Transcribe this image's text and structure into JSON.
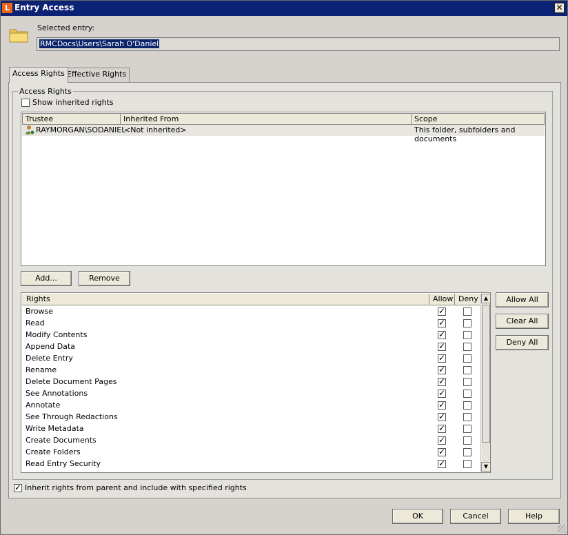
{
  "window": {
    "title": "Entry Access",
    "app_icon_letter": "L",
    "close_glyph": "✕"
  },
  "selected_entry": {
    "label": "Selected entry:",
    "value": "RMCDocs\\Users\\Sarah O'Daniel"
  },
  "tabs": [
    {
      "label": "Access Rights",
      "active": true
    },
    {
      "label": "Effective Rights",
      "active": false
    }
  ],
  "group_label": "Access Rights",
  "show_inherited": {
    "label": "Show inherited rights",
    "checked": false
  },
  "trustee_table": {
    "columns": [
      "Trustee",
      "Inherited From",
      "Scope"
    ],
    "rows": [
      {
        "trustee": "RAYMORGAN\\SODANIEL",
        "inherited_from": "<Not inherited>",
        "scope": "This folder, subfolders and documents"
      }
    ]
  },
  "trustee_buttons": {
    "add": "Add...",
    "remove": "Remove"
  },
  "rights_table": {
    "columns": [
      "Rights",
      "Allow",
      "Deny"
    ],
    "rows": [
      {
        "name": "Browse",
        "allow": true,
        "deny": false
      },
      {
        "name": "Read",
        "allow": true,
        "deny": false
      },
      {
        "name": "Modify Contents",
        "allow": true,
        "deny": false
      },
      {
        "name": "Append Data",
        "allow": true,
        "deny": false
      },
      {
        "name": "Delete Entry",
        "allow": true,
        "deny": false
      },
      {
        "name": "Rename",
        "allow": true,
        "deny": false
      },
      {
        "name": "Delete Document Pages",
        "allow": true,
        "deny": false
      },
      {
        "name": "See Annotations",
        "allow": true,
        "deny": false
      },
      {
        "name": "Annotate",
        "allow": true,
        "deny": false
      },
      {
        "name": "See Through Redactions",
        "allow": true,
        "deny": false
      },
      {
        "name": "Write Metadata",
        "allow": true,
        "deny": false
      },
      {
        "name": "Create Documents",
        "allow": true,
        "deny": false
      },
      {
        "name": "Create Folders",
        "allow": true,
        "deny": false
      },
      {
        "name": "Read Entry Security",
        "allow": true,
        "deny": false
      }
    ]
  },
  "rights_buttons": {
    "allow_all": "Allow All",
    "clear_all": "Clear All",
    "deny_all": "Deny All"
  },
  "inherit_rights": {
    "label": "Inherit rights from parent and include with specified rights",
    "checked": true
  },
  "footer": {
    "ok": "OK",
    "cancel": "Cancel",
    "help": "Help"
  },
  "colors": {
    "titlebar": "#0c2274",
    "app_icon": "#e8651a",
    "selection": "#0a246a"
  }
}
